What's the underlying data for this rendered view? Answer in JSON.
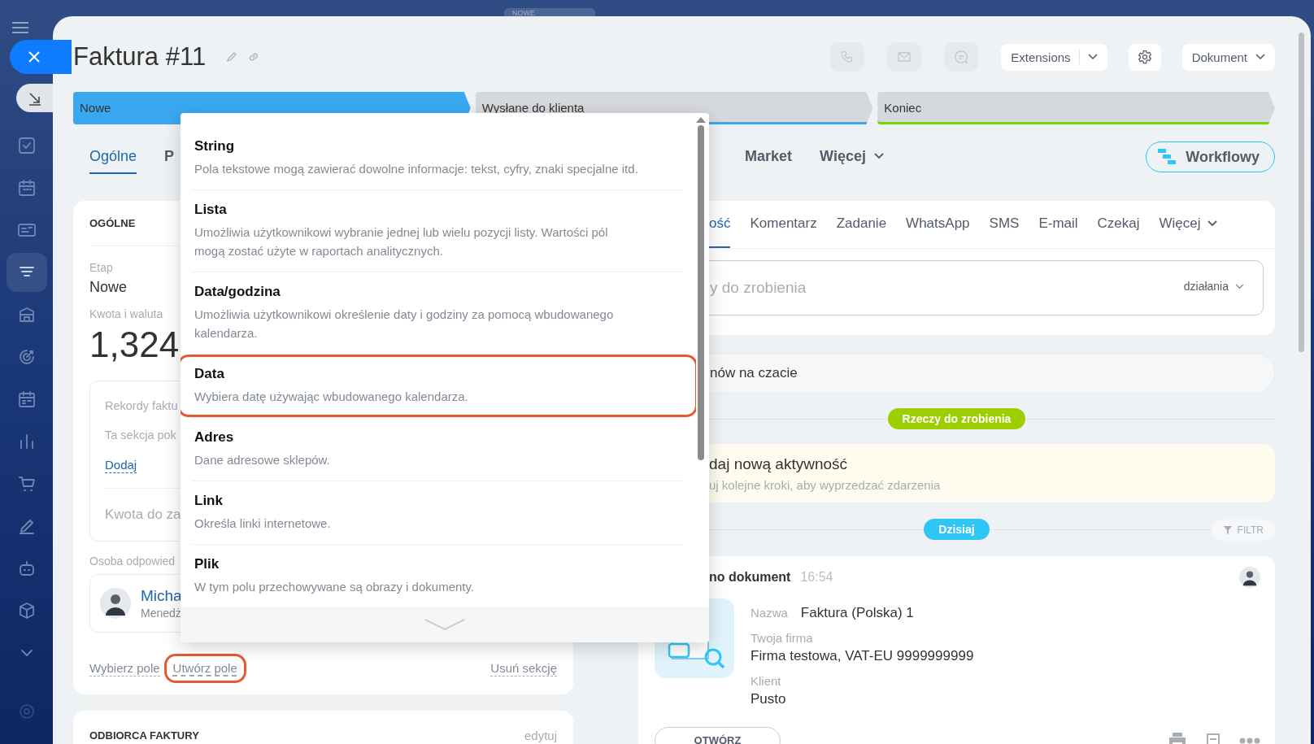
{
  "top_tab": "NOWE",
  "sidebar": {
    "items": [
      {
        "kind": "tasks",
        "selected": false
      },
      {
        "kind": "calendar",
        "selected": false
      },
      {
        "kind": "contacts",
        "selected": false
      },
      {
        "kind": "pipeline",
        "selected": true
      },
      {
        "kind": "building",
        "selected": false
      },
      {
        "kind": "target",
        "selected": false
      },
      {
        "kind": "schedule",
        "selected": false
      },
      {
        "kind": "chart",
        "selected": false
      },
      {
        "kind": "cart",
        "selected": false
      },
      {
        "kind": "sign",
        "selected": false
      },
      {
        "kind": "robot",
        "selected": false
      },
      {
        "kind": "cube",
        "selected": false
      },
      {
        "kind": "more",
        "selected": false
      },
      {
        "kind": "settings",
        "selected": false
      }
    ]
  },
  "title": "Faktura #11",
  "header_buttons": {
    "extensions": "Extensions",
    "document": "Dokument"
  },
  "stages": [
    {
      "label": "Nowe",
      "color": "#39a8ef",
      "selected": true
    },
    {
      "label": "Wysłane do klienta",
      "color": "#39a8ef",
      "selected": false
    },
    {
      "label": "Koniec",
      "color": "#7bd500",
      "selected": false
    }
  ],
  "tabs": [
    {
      "label": "Ogólne",
      "kind": "tab",
      "selected": true
    },
    {
      "label": "P",
      "kind": "tab",
      "selected": false
    },
    {
      "label": "Market",
      "kind": "tab",
      "selected": false
    },
    {
      "label": "Więcej",
      "kind": "menu",
      "selected": false
    }
  ],
  "workflow_button": "Workflowy",
  "general_section": {
    "heading": "OGÓLNE",
    "stage_label": "Etap",
    "stage_value": "Nowe",
    "amount_label": "Kwota i waluta",
    "amount_value": "1,324",
    "records": {
      "title": "Rekordy faktu",
      "text": "Ta sekcja pok",
      "link": "Dodaj",
      "amount_label": "Kwota do za"
    },
    "responsible": {
      "label": "Osoba odpowied",
      "name": "Micha",
      "role": "Menedż"
    },
    "actions": [
      {
        "label": "Wybierz pole",
        "highlighted": false
      },
      {
        "label": "Utwórz pole",
        "highlighted": true
      },
      {
        "label": "Usuń sekcję",
        "highlighted": false
      }
    ]
  },
  "recipient_section": {
    "heading": "ODBIORCA FAKTURY",
    "action": "edytuj"
  },
  "activity": {
    "tabs": [
      {
        "label": "ość",
        "kind": "tab",
        "selected": true
      },
      {
        "label": "Komentarz",
        "kind": "tab",
        "selected": false
      },
      {
        "label": "Zadanie",
        "kind": "tab",
        "selected": false
      },
      {
        "label": "WhatsApp",
        "kind": "tab",
        "selected": false
      },
      {
        "label": "SMS",
        "kind": "tab",
        "selected": false
      },
      {
        "label": "E-mail",
        "kind": "tab",
        "selected": false
      },
      {
        "label": "Czekaj",
        "kind": "tab",
        "selected": false
      },
      {
        "label": "Więcej",
        "kind": "menu",
        "selected": false
      }
    ],
    "input": {
      "placeholder": "y do zrobienia",
      "actions": "działania"
    }
  },
  "chat": "nów na czacie",
  "todo_badge": "Rzeczy do zrobienia",
  "new_activity": {
    "title": "daj nową aktywność",
    "subtitle": "uj kolejne kroki, aby wyprzedzać zdarzenia"
  },
  "today_badge": "Dzisiaj",
  "filter": "FILTR",
  "document": {
    "title": "no dokument",
    "time": "16:54",
    "fields": [
      {
        "label": "Nazwa",
        "value": "Faktura (Polska) 1",
        "kind": "inline"
      },
      {
        "label": "Twoja firma",
        "value": "Firma testowa, VAT-EU 9999999999",
        "kind": "stacked"
      },
      {
        "label": "Klient",
        "value": "Pusto",
        "kind": "stacked"
      }
    ],
    "open_button": "OTWÓRZ"
  },
  "field_types_menu": {
    "items": [
      {
        "title": "String",
        "description": "Pola tekstowe mogą zawierać dowolne informacje: tekst, cyfry, znaki specjalne itd.",
        "highlighted": false
      },
      {
        "title": "Lista",
        "description": "Umożliwia użytkownikowi wybranie jednej lub wielu pozycji listy. Wartości pól mogą zostać użyte w raportach analitycznych.",
        "highlighted": false
      },
      {
        "title": "Data/godzina",
        "description": "Umożliwia użytkownikowi określenie daty i godziny za pomocą wbudowanego kalendarza.",
        "highlighted": false
      },
      {
        "title": "Data",
        "description": "Wybiera datę używając wbudowanego kalendarza.",
        "highlighted": true
      },
      {
        "title": "Adres",
        "description": "Dane adresowe sklepów.",
        "highlighted": false
      },
      {
        "title": "Link",
        "description": "Określa linki internetowe.",
        "highlighted": false
      },
      {
        "title": "Plik",
        "description": "W tym polu przechowywane są obrazy i dokumenty.",
        "highlighted": false
      }
    ]
  }
}
